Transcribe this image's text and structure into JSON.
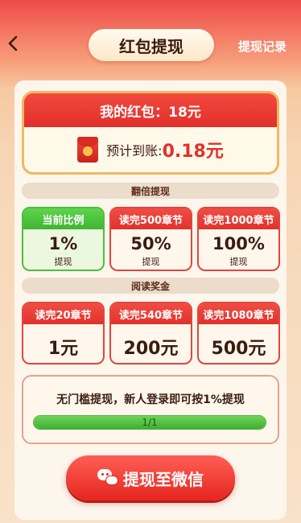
{
  "header": {
    "title": "红包提现",
    "record_link": "提现记录"
  },
  "wallet": {
    "balance_text": "我的红包：18元",
    "estimate_label": "预计到账:",
    "estimate_value": "0.18元"
  },
  "multiplier_section": {
    "title": "翻倍提现",
    "tiles": [
      {
        "header": "当前比例",
        "value": "1%",
        "sub": "提现",
        "active": true
      },
      {
        "header": "读完500章节",
        "value": "50%",
        "sub": "提现",
        "active": false
      },
      {
        "header": "读完1000章节",
        "value": "100%",
        "sub": "提现",
        "active": false
      }
    ]
  },
  "reading_bonus_section": {
    "title": "阅读奖金",
    "tiles": [
      {
        "header": "读完20章节",
        "value": "1元"
      },
      {
        "header": "读完540章节",
        "value": "200元"
      },
      {
        "header": "读完1080章节",
        "value": "500元"
      }
    ]
  },
  "progress": {
    "text": "无门槛提现，新人登录即可按1%提现",
    "label": "1/1",
    "fraction": 1.0
  },
  "withdraw_button": {
    "label": "提现至微信"
  },
  "colors": {
    "accent_red": "#e2312b",
    "active_green": "#4cbf3a",
    "gold_border": "#f1b85f"
  }
}
